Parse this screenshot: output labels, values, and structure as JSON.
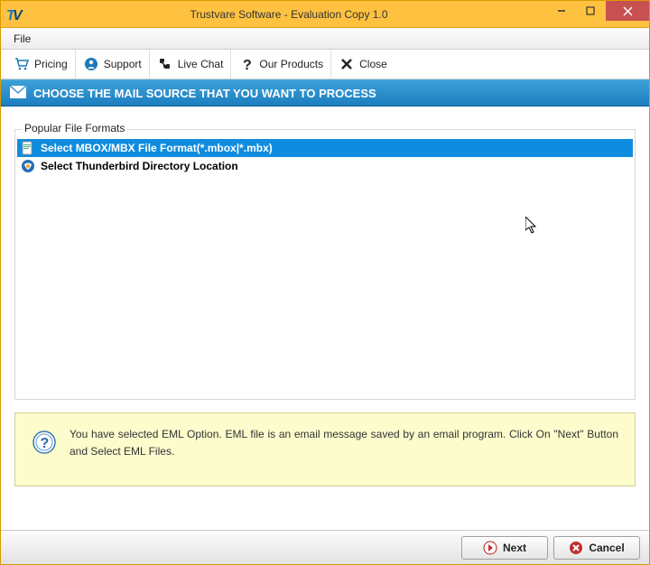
{
  "window": {
    "title": "Trustvare Software - Evaluation Copy 1.0"
  },
  "menu": {
    "file": "File"
  },
  "toolbar": {
    "pricing": "Pricing",
    "support": "Support",
    "live_chat": "Live Chat",
    "our_products": "Our Products",
    "close": "Close"
  },
  "banner": {
    "text": "CHOOSE THE MAIL SOURCE THAT YOU WANT TO PROCESS"
  },
  "groupbox": {
    "legend": "Popular File Formats",
    "options": [
      {
        "label": "Select MBOX/MBX File Format(*.mbox|*.mbx)",
        "selected": true
      },
      {
        "label": "Select Thunderbird Directory Location",
        "selected": false
      }
    ]
  },
  "info": {
    "text": "You have selected EML Option. EML file is an email message saved by an email program. Click On \"Next\" Button and Select EML Files."
  },
  "footer": {
    "next": "Next",
    "cancel": "Cancel"
  }
}
